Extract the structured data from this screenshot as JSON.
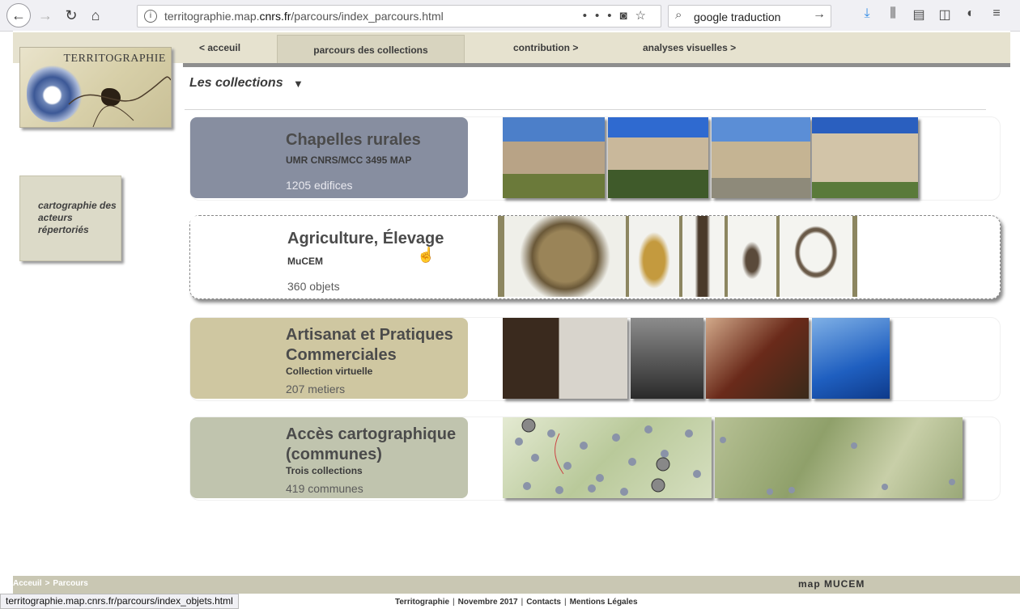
{
  "browser": {
    "url_prefix": "territographie.map.",
    "url_domain": "cnrs.fr",
    "url_path": "/parcours/index_parcours.html",
    "search_value": "google traduction",
    "status_url": "territographie.map.cnrs.fr/parcours/index_objets.html"
  },
  "nav": {
    "accueil": "< acceuil",
    "parcours": "parcours des collections",
    "contribution": "contribution >",
    "analyses": "analyses visuelles >"
  },
  "logo_text": "TERRITOGRAPHIE",
  "sidebar_box": "cartographie des acteurs répertoriés",
  "section_title": "Les collections",
  "collections": [
    {
      "title": "Chapelles rurales",
      "subtitle": "UMR CNRS/MCC 3495 MAP",
      "count": "1205 edifices",
      "color": "#878ea0"
    },
    {
      "title": "Agriculture, Élevage",
      "subtitle": "MuCEM",
      "count": "360 objets",
      "color": "#ffffff"
    },
    {
      "title": "Artisanat et Pratiques Commerciales",
      "subtitle": "Collection virtuelle",
      "count": "207 metiers",
      "color": "#cfc7a1"
    },
    {
      "title": "Accès cartographique (communes)",
      "subtitle": "Trois collections",
      "count": "419 communes",
      "color": "#c0c4ae"
    }
  ],
  "breadcrumb": {
    "home": "Acceuil",
    "current": "Parcours"
  },
  "partners": "map  MUCEM",
  "footer": {
    "site": "Territographie",
    "date": "Novembre 2017",
    "contacts": "Contacts",
    "legal": "Mentions Légales"
  }
}
